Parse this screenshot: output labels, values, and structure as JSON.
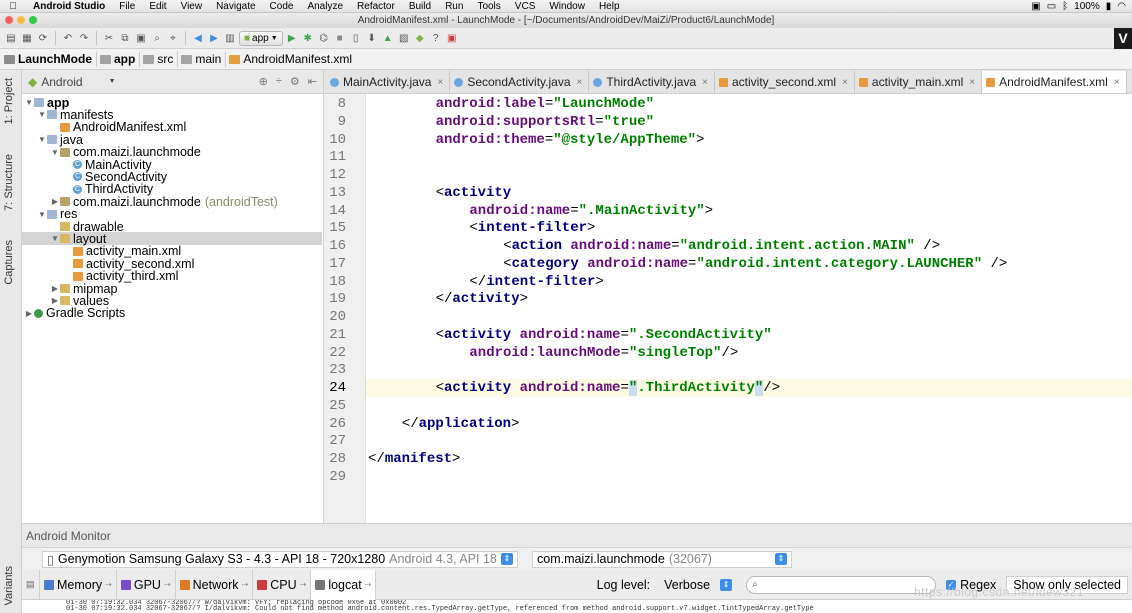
{
  "menubar": {
    "app_name": "Android Studio",
    "items": [
      "File",
      "Edit",
      "View",
      "Navigate",
      "Code",
      "Analyze",
      "Refactor",
      "Build",
      "Run",
      "Tools",
      "VCS",
      "Window",
      "Help"
    ],
    "battery": "100%",
    "wifi_icon": "wifi-icon"
  },
  "window": {
    "title": "AndroidManifest.xml - LaunchMode - [~/Documents/AndroidDev/MaiZi/Product6/LaunchMode]"
  },
  "toolbar": {
    "run_config": "app"
  },
  "breadcrumb": [
    "LaunchMode",
    "app",
    "src",
    "main",
    "AndroidManifest.xml"
  ],
  "side_tabs": [
    "1: Project",
    "7: Structure",
    "Captures"
  ],
  "bottom_side_tab": "Variants",
  "project_panel": {
    "view_mode": "Android",
    "tree": [
      {
        "label": "app",
        "depth": 0,
        "arrow": "▼",
        "icon": "folder",
        "bold": true
      },
      {
        "label": "manifests",
        "depth": 1,
        "arrow": "▼",
        "icon": "folder"
      },
      {
        "label": "AndroidManifest.xml",
        "depth": 2,
        "arrow": "",
        "icon": "xml"
      },
      {
        "label": "java",
        "depth": 1,
        "arrow": "▼",
        "icon": "folder"
      },
      {
        "label": "com.maizi.launchmode",
        "depth": 2,
        "arrow": "▼",
        "icon": "pkg"
      },
      {
        "label": "MainActivity",
        "depth": 3,
        "arrow": "",
        "icon": "cls"
      },
      {
        "label": "SecondActivity",
        "depth": 3,
        "arrow": "",
        "icon": "cls"
      },
      {
        "label": "ThirdActivity",
        "depth": 3,
        "arrow": "",
        "icon": "cls"
      },
      {
        "label": "com.maizi.launchmode",
        "depth": 2,
        "arrow": "▶",
        "icon": "pkg",
        "suffix": "(androidTest)"
      },
      {
        "label": "res",
        "depth": 1,
        "arrow": "▼",
        "icon": "folder"
      },
      {
        "label": "drawable",
        "depth": 2,
        "arrow": "",
        "icon": "res"
      },
      {
        "label": "layout",
        "depth": 2,
        "arrow": "▼",
        "icon": "res",
        "selected": true
      },
      {
        "label": "activity_main.xml",
        "depth": 3,
        "arrow": "",
        "icon": "xml"
      },
      {
        "label": "activity_second.xml",
        "depth": 3,
        "arrow": "",
        "icon": "xml"
      },
      {
        "label": "activity_third.xml",
        "depth": 3,
        "arrow": "",
        "icon": "xml"
      },
      {
        "label": "mipmap",
        "depth": 2,
        "arrow": "▶",
        "icon": "res"
      },
      {
        "label": "values",
        "depth": 2,
        "arrow": "▶",
        "icon": "res"
      },
      {
        "label": "Gradle Scripts",
        "depth": 0,
        "arrow": "▶",
        "icon": "gradle"
      }
    ]
  },
  "editor_tabs": [
    {
      "label": "MainActivity.java",
      "type": "c"
    },
    {
      "label": "SecondActivity.java",
      "type": "c"
    },
    {
      "label": "ThirdActivity.java",
      "type": "c"
    },
    {
      "label": "activity_second.xml",
      "type": "x"
    },
    {
      "label": "activity_main.xml",
      "type": "x"
    },
    {
      "label": "AndroidManifest.xml",
      "type": "x",
      "active": true
    }
  ],
  "code_lines": [
    {
      "n": "8",
      "indent": 8,
      "parts": [
        [
          "attr",
          "android:label"
        ],
        [
          "punct",
          "="
        ],
        [
          "val",
          "\"LaunchMode\""
        ]
      ]
    },
    {
      "n": "9",
      "indent": 8,
      "parts": [
        [
          "attr",
          "android:supportsRtl"
        ],
        [
          "punct",
          "="
        ],
        [
          "val",
          "\"true\""
        ]
      ]
    },
    {
      "n": "10",
      "indent": 8,
      "parts": [
        [
          "attr",
          "android:theme"
        ],
        [
          "punct",
          "="
        ],
        [
          "val",
          "\"@style/AppTheme\""
        ],
        [
          "punct",
          ">"
        ]
      ]
    },
    {
      "n": "11",
      "indent": 0,
      "parts": []
    },
    {
      "n": "12",
      "indent": 0,
      "parts": []
    },
    {
      "n": "13",
      "indent": 8,
      "parts": [
        [
          "punct",
          "<"
        ],
        [
          "tag",
          "activity"
        ]
      ]
    },
    {
      "n": "14",
      "indent": 12,
      "parts": [
        [
          "attr",
          "android:name"
        ],
        [
          "punct",
          "="
        ],
        [
          "val",
          "\".MainActivity\""
        ],
        [
          "punct",
          ">"
        ]
      ]
    },
    {
      "n": "15",
      "indent": 12,
      "parts": [
        [
          "punct",
          "<"
        ],
        [
          "tag",
          "intent-filter"
        ],
        [
          "punct",
          ">"
        ]
      ]
    },
    {
      "n": "16",
      "indent": 16,
      "parts": [
        [
          "punct",
          "<"
        ],
        [
          "tag",
          "action "
        ],
        [
          "attr",
          "android:name"
        ],
        [
          "punct",
          "="
        ],
        [
          "val",
          "\"android.intent.action.MAIN\""
        ],
        [
          "punct",
          " />"
        ]
      ]
    },
    {
      "n": "17",
      "indent": 16,
      "parts": [
        [
          "punct",
          "<"
        ],
        [
          "tag",
          "category "
        ],
        [
          "attr",
          "android:name"
        ],
        [
          "punct",
          "="
        ],
        [
          "val",
          "\"android.intent.category.LAUNCHER\""
        ],
        [
          "punct",
          " />"
        ]
      ]
    },
    {
      "n": "18",
      "indent": 12,
      "parts": [
        [
          "punct",
          "</"
        ],
        [
          "tag",
          "intent-filter"
        ],
        [
          "punct",
          ">"
        ]
      ]
    },
    {
      "n": "19",
      "indent": 8,
      "parts": [
        [
          "punct",
          "</"
        ],
        [
          "tag",
          "activity"
        ],
        [
          "punct",
          ">"
        ]
      ]
    },
    {
      "n": "20",
      "indent": 0,
      "parts": []
    },
    {
      "n": "21",
      "indent": 8,
      "parts": [
        [
          "punct",
          "<"
        ],
        [
          "tag",
          "activity "
        ],
        [
          "attr",
          "android:name"
        ],
        [
          "punct",
          "="
        ],
        [
          "val",
          "\".SecondActivity\""
        ]
      ]
    },
    {
      "n": "22",
      "indent": 12,
      "parts": [
        [
          "attr",
          "android:launchMode"
        ],
        [
          "punct",
          "="
        ],
        [
          "val",
          "\"singleTop\""
        ],
        [
          "punct",
          "/>"
        ]
      ]
    },
    {
      "n": "23",
      "indent": 0,
      "parts": []
    },
    {
      "n": "24",
      "indent": 8,
      "current": true,
      "parts": [
        [
          "punct",
          "<"
        ],
        [
          "tag",
          "activity "
        ],
        [
          "attr",
          "android:name"
        ],
        [
          "punct",
          "="
        ],
        [
          "valhl",
          "\""
        ],
        [
          "val",
          ".ThirdActivity"
        ],
        [
          "valhl",
          "\""
        ],
        [
          "punct",
          "/>"
        ]
      ]
    },
    {
      "n": "25",
      "indent": 0,
      "parts": []
    },
    {
      "n": "26",
      "indent": 4,
      "parts": [
        [
          "punct",
          "</"
        ],
        [
          "tag",
          "application"
        ],
        [
          "punct",
          ">"
        ]
      ]
    },
    {
      "n": "27",
      "indent": 0,
      "parts": []
    },
    {
      "n": "28",
      "indent": 0,
      "parts": [
        [
          "punct",
          "</"
        ],
        [
          "tag",
          "manifest"
        ],
        [
          "punct",
          ">"
        ]
      ]
    },
    {
      "n": "29",
      "indent": 0,
      "parts": []
    }
  ],
  "monitor": {
    "title": "Android Monitor",
    "device": "Genymotion Samsung Galaxy S3 - 4.3 - API 18 - 720x1280",
    "device_detail": "Android 4.3, API 18",
    "process": "com.maizi.launchmode",
    "process_pid": "(32067)",
    "tabs": [
      {
        "label": "Memory",
        "color": "#4a7bd0"
      },
      {
        "label": "GPU",
        "color": "#7a4ad0"
      },
      {
        "label": "Network",
        "color": "#e07a20"
      },
      {
        "label": "CPU",
        "color": "#d03a3a"
      },
      {
        "label": "logcat",
        "color": "#777777",
        "active": true
      }
    ],
    "log_level_label": "Log level:",
    "log_level": "Verbose",
    "regex_label": "Regex",
    "show_only_selected": "Show only selected",
    "log_text_1": "01-30 07:19:32.034 32067-32067/? W/dalvikvm: VFY: replacing opcode 0x6e at 0x0002",
    "log_text_2": "01-30 07:19:32.034 32067-32067/? I/dalvikvm: Could not find method android.content.res.TypedArray.getType, referenced from method android.support.v7.widget.TintTypedArray.getType"
  },
  "watermark": "https://blog.csdn.net/ldew321"
}
